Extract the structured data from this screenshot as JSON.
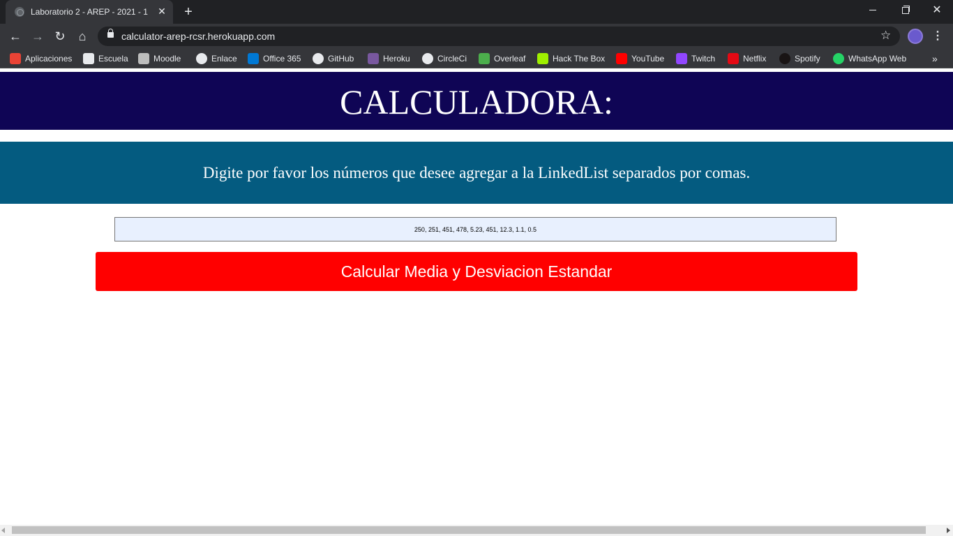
{
  "browser": {
    "tab_title": "Laboratorio 2 - AREP - 2021 - 1",
    "tab_close_glyph": "✕",
    "new_tab_glyph": "+",
    "url": "calculator-arep-rcsr.herokuapp.com",
    "bookmarks": [
      {
        "label": "Aplicaciones",
        "icon": "apps-grid-icon",
        "color": "#ea4335"
      },
      {
        "label": "Escuela",
        "icon": "escuela-icon",
        "color": "#e8eaed"
      },
      {
        "label": "Moodle",
        "icon": "moodle-icon",
        "color": "#bdbdbd"
      },
      {
        "label": "Enlace",
        "icon": "globe-icon",
        "color": "#e8eaed"
      },
      {
        "label": "Office 365",
        "icon": "outlook-icon",
        "color": "#0078d4"
      },
      {
        "label": "GitHub",
        "icon": "github-icon",
        "color": "#e8eaed"
      },
      {
        "label": "Heroku",
        "icon": "heroku-icon",
        "color": "#79589f"
      },
      {
        "label": "CircleCi",
        "icon": "circleci-icon",
        "color": "#e8eaed"
      },
      {
        "label": "Overleaf",
        "icon": "overleaf-icon",
        "color": "#4cae4c"
      },
      {
        "label": "Hack The Box",
        "icon": "hackthebox-icon",
        "color": "#9fef00"
      },
      {
        "label": "YouTube",
        "icon": "youtube-icon",
        "color": "#ff0000"
      },
      {
        "label": "Twitch",
        "icon": "twitch-icon",
        "color": "#9146ff"
      },
      {
        "label": "Netflix",
        "icon": "netflix-icon",
        "color": "#e50914"
      },
      {
        "label": "Spotify",
        "icon": "spotify-icon",
        "color": "#191414"
      },
      {
        "label": "WhatsApp Web",
        "icon": "whatsapp-icon",
        "color": "#25d366"
      }
    ],
    "bookmarks_overflow_glyph": "»"
  },
  "page": {
    "title": "CALCULADORA:",
    "instruction": "Digite por favor los números que desee agregar a la LinkedList separados por comas.",
    "numbers_value": "250, 251, 451, 478, 5.23, 451, 12.3, 1.1, 0.5",
    "calculate_button_label": "Calcular Media y Desviacion Estandar"
  },
  "colors": {
    "header_bg": "#0f0555",
    "instruction_bg": "#045b80",
    "input_bg": "#e8f0fe",
    "button_bg": "#ff0000"
  }
}
